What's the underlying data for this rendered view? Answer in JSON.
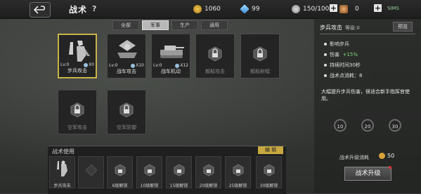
{
  "header": {
    "title": "战术",
    "help": "?",
    "gold": "1060",
    "gems": "99",
    "capacity": "150/100",
    "medals": "0",
    "system": "SIMS"
  },
  "tabs": [
    {
      "label": "全部",
      "active": false
    },
    {
      "label": "军事",
      "active": true
    },
    {
      "label": "生产",
      "active": false
    },
    {
      "label": "通用",
      "active": false
    }
  ],
  "cards": [
    {
      "name": "步兵攻击",
      "level": "Lv:0",
      "count": "X0",
      "unlocked": true
    },
    {
      "name": "战车攻击",
      "level": "Lv:0",
      "count": "X10",
      "unlocked": true
    },
    {
      "name": "战车机动",
      "level": "Lv:0",
      "count": "X12",
      "unlocked": true
    },
    {
      "name": "舰船攻击",
      "unlocked": false
    },
    {
      "name": "舰船射程",
      "unlocked": false
    },
    {
      "name": "空军攻击",
      "unlocked": false
    },
    {
      "name": "空军防御",
      "unlocked": false
    }
  ],
  "usage": {
    "title": "战术使用",
    "edit": "编 辑",
    "slots": [
      {
        "label": "步兵攻击"
      },
      {
        "label": ""
      },
      {
        "label": "6级解锁"
      },
      {
        "label": "10级解锁"
      },
      {
        "label": "15级解锁"
      },
      {
        "label": "20级解锁"
      },
      {
        "label": "25级解锁"
      },
      {
        "label": "30级解锁"
      }
    ]
  },
  "detail": {
    "name": "步兵攻击",
    "level": "等级:0",
    "preview": "预览",
    "stat1": "影响步兵",
    "stat2_label": "伤害",
    "stat2_value": "+15%",
    "stat3": "持续时间30秒",
    "stat4": "战术点消耗：8",
    "description": "大幅提升步兵伤害，很适合新手指挥官使用。",
    "levels": [
      "10",
      "20",
      "30"
    ],
    "cost_label": "战术升级消耗",
    "cost_value": "50",
    "upgrade": "战术升级"
  }
}
